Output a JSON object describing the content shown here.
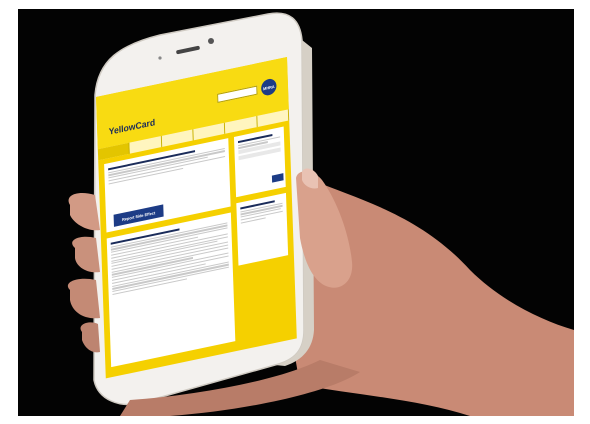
{
  "screen": {
    "logo": "YellowCard",
    "badge": "MHRA",
    "report_button": "Report Side Effect"
  },
  "colors": {
    "background": "#030303",
    "phone_body": "#f3f1ee",
    "site_yellow": "#f5d000",
    "site_navy": "#1d3c86",
    "skin": "#d29a85"
  }
}
